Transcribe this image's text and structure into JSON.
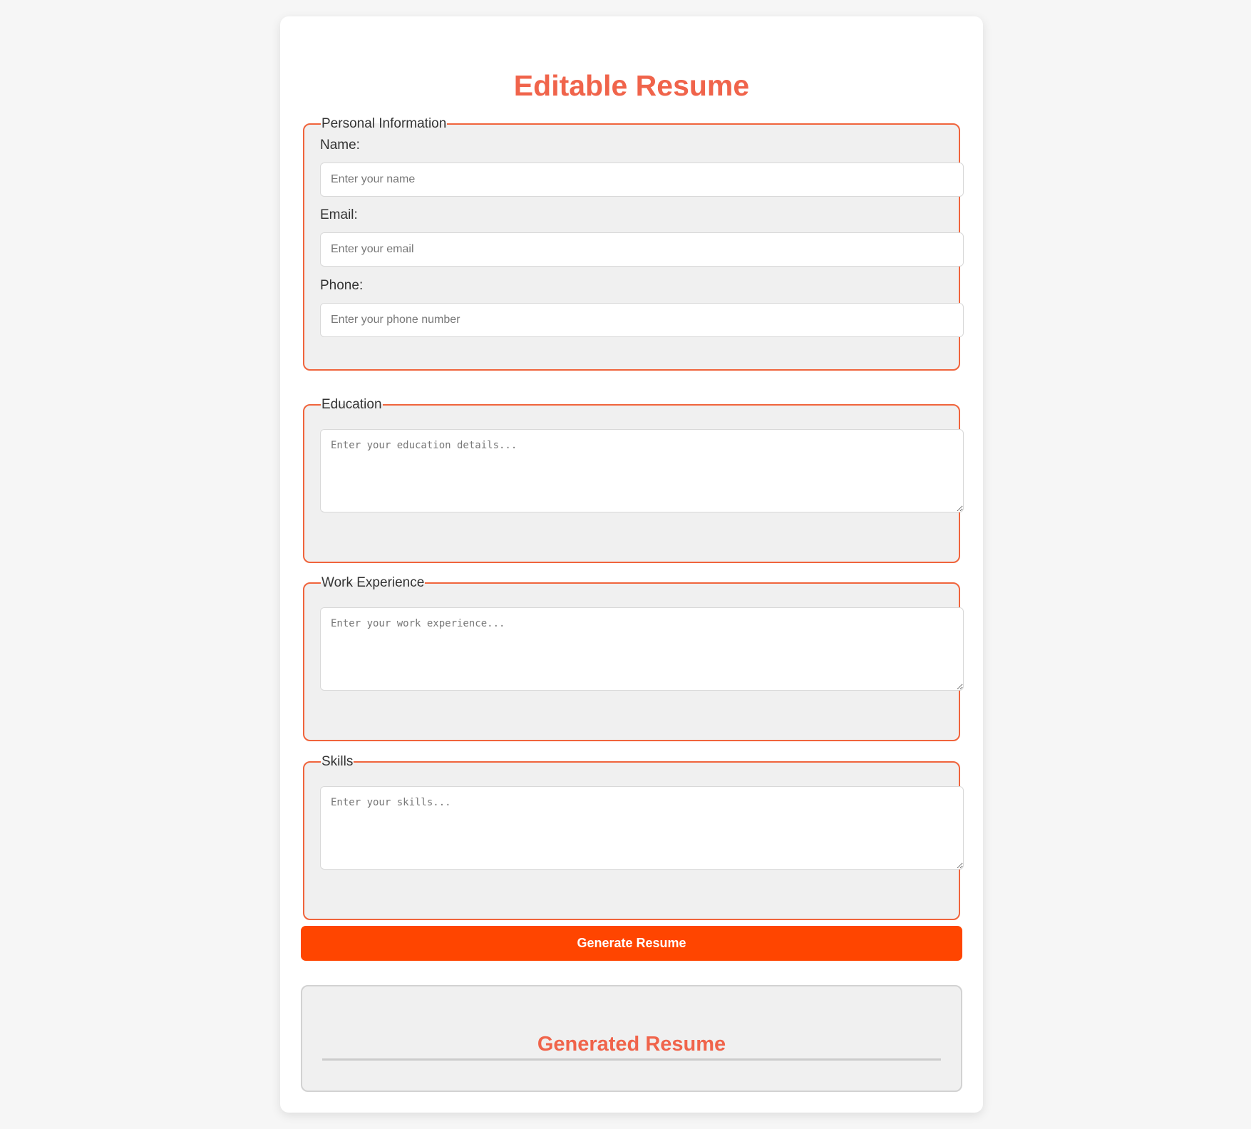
{
  "page": {
    "title": "Editable Resume"
  },
  "personal": {
    "legend": "Personal Information",
    "name_label": "Name:",
    "name_placeholder": "Enter your name",
    "email_label": "Email:",
    "email_placeholder": "Enter your email",
    "phone_label": "Phone:",
    "phone_placeholder": "Enter your phone number"
  },
  "education": {
    "legend": "Education",
    "placeholder": "Enter your education details..."
  },
  "work": {
    "legend": "Work Experience",
    "placeholder": "Enter your work experience..."
  },
  "skills": {
    "legend": "Skills",
    "placeholder": "Enter your skills..."
  },
  "actions": {
    "generate_label": "Generate Resume"
  },
  "output": {
    "title": "Generated Resume"
  },
  "colors": {
    "accent": "#ff4500",
    "heading": "#f0644b",
    "fieldset_border": "#f0643c",
    "panel_bg": "#f0f0f0",
    "page_bg": "#f6f6f6"
  }
}
